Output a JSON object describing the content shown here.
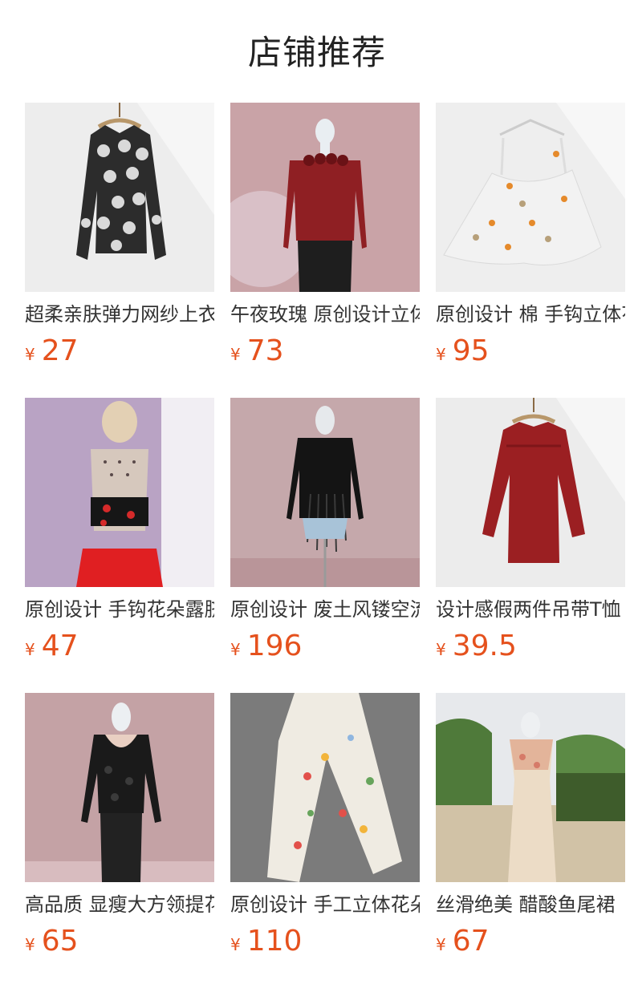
{
  "section": {
    "title": "店铺推荐"
  },
  "currency_symbol": "¥",
  "products": [
    {
      "name": "超柔亲肤弹力网纱上衣",
      "price": "27",
      "image": "black-floral-mesh-top-on-hanger"
    },
    {
      "name": "午夜玫瑰 原创设计立体",
      "price": "73",
      "image": "red-rose-neckline-top-on-mannequin"
    },
    {
      "name": "原创设计 棉 手钩立体花",
      "price": "95",
      "image": "white-lace-camisole-with-flowers"
    },
    {
      "name": "原创设计 手钩花朵露脐",
      "price": "47",
      "image": "sheer-dotted-crop-top-on-mannequin"
    },
    {
      "name": "原创设计 废土风镂空流苏",
      "price": "196",
      "image": "black-tassel-knit-top-on-mannequin"
    },
    {
      "name": "设计感假两件吊带T恤",
      "price": "39.5",
      "image": "red-layered-long-sleeve-tee"
    },
    {
      "name": "高品质 显瘦大方领提花",
      "price": "65",
      "image": "black-lace-square-neck-top"
    },
    {
      "name": "原创设计 手工立体花朵",
      "price": "110",
      "image": "white-knit-pants-with-flowers"
    },
    {
      "name": "丝滑绝美 醋酸鱼尾裙",
      "price": "67",
      "image": "champagne-satin-mermaid-dress"
    }
  ]
}
